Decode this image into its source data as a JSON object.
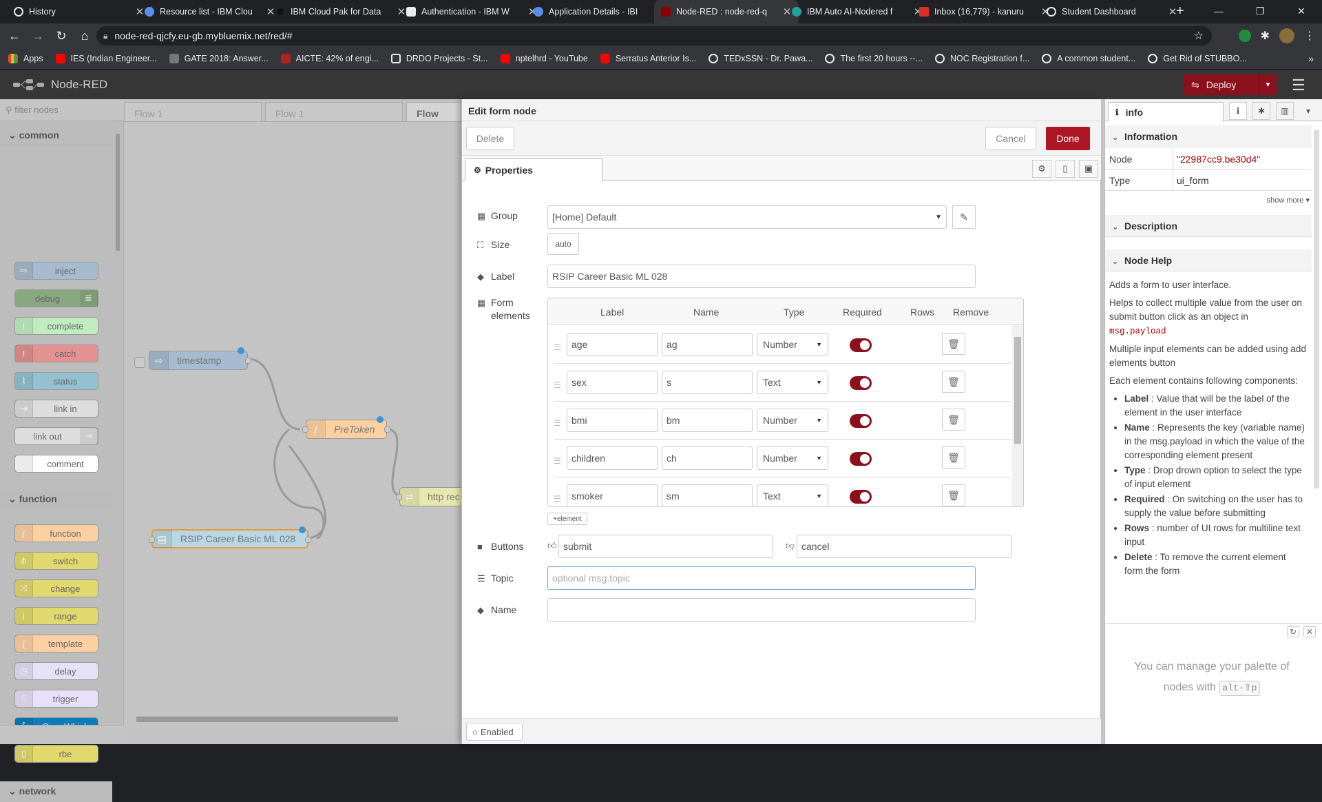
{
  "browser": {
    "tabs": [
      {
        "title": "History",
        "active": false
      },
      {
        "title": "Resource list - IBM Clou",
        "active": false
      },
      {
        "title": "IBM Cloud Pak for Data",
        "active": false
      },
      {
        "title": "Authentication - IBM W",
        "active": false
      },
      {
        "title": "Application Details - IBI",
        "active": false
      },
      {
        "title": "Node-RED : node-red-q",
        "active": true
      },
      {
        "title": "IBM Auto AI-Nodered f",
        "active": false
      },
      {
        "title": "Inbox (16,779) - kanuru",
        "active": false
      },
      {
        "title": "Student Dashboard",
        "active": false
      }
    ],
    "url": "node-red-qjcfy.eu-gb.mybluemix.net/red/#",
    "bookmarks": [
      "Apps",
      "IES (Indian Engineer...",
      "GATE 2018: Answer...",
      "AICTE: 42% of engi...",
      "DRDO Projects - St...",
      "nptelhrd - YouTube",
      "Serratus Anterior Is...",
      "TEDxSSN - Dr. Pawa...",
      "The first 20 hours --...",
      "NOC Registration f...",
      "A common student...",
      "Get Rid of STUBBO..."
    ]
  },
  "header": {
    "title": "Node-RED",
    "deploy_label": "Deploy"
  },
  "palette": {
    "filter_placeholder": "filter nodes",
    "categories": [
      {
        "name": "common",
        "nodes": [
          "inject",
          "debug",
          "complete",
          "catch",
          "status",
          "link in",
          "link out",
          "comment"
        ]
      },
      {
        "name": "function",
        "nodes": [
          "function",
          "switch",
          "change",
          "range",
          "template",
          "delay",
          "trigger",
          "OpenWhisk",
          "rbe"
        ]
      },
      {
        "name": "network",
        "nodes": []
      }
    ]
  },
  "workspace": {
    "flow_tabs": [
      "Flow 1",
      "Flow 1",
      "Flow"
    ],
    "nodes": [
      "timestamp",
      "PreToken",
      "RSIP Career Basic ML 028",
      "http rec"
    ]
  },
  "editor": {
    "title": "Edit form node",
    "delete_label": "Delete",
    "cancel_label": "Cancel",
    "done_label": "Done",
    "properties_tab": "Properties",
    "group_label": "Group",
    "group_value": "[Home] Default",
    "size_label": "Size",
    "size_value": "auto",
    "label_label": "Label",
    "label_value": "RSIP Career Basic ML 028",
    "form_elements_label": "Form elements",
    "columns": [
      "Label",
      "Name",
      "Type",
      "Required",
      "Rows",
      "Remove"
    ],
    "elements": [
      {
        "label": "age",
        "name": "ag",
        "type": "Number",
        "required": true
      },
      {
        "label": "sex",
        "name": "s",
        "type": "Text",
        "required": true
      },
      {
        "label": "bmi",
        "name": "bm",
        "type": "Number",
        "required": true
      },
      {
        "label": "children",
        "name": "ch",
        "type": "Number",
        "required": true
      },
      {
        "label": "smoker",
        "name": "sm",
        "type": "Text",
        "required": true
      }
    ],
    "add_element_label": "element",
    "buttons_label": "Buttons",
    "submit_value": "submit",
    "cancel_value": "cancel",
    "topic_label": "Topic",
    "topic_placeholder": "optional msg.topic",
    "name_label": "Name",
    "name_value": "",
    "enabled_label": "Enabled"
  },
  "sidebar": {
    "tab_label": "info",
    "information_title": "Information",
    "node_key": "Node",
    "node_value": "\"22987cc9.be30d4\"",
    "type_key": "Type",
    "type_value": "ui_form",
    "show_more": "show more",
    "description_title": "Description",
    "help_title": "Node Help",
    "help_intro": "Adds a form to user interface.",
    "help_p2a": "Helps to collect multiple value from the user on submit button click as an object in",
    "help_p2code": "msg.payload",
    "help_p3": "Multiple input elements can be added using add elements button",
    "help_p4": "Each element contains following components:",
    "help_items": [
      {
        "term": "Label",
        "text": ": Value that will be the label of the element in the user interface"
      },
      {
        "term": "Name",
        "text": ": Represents the key (variable name) in the msg.payload in which the value of the corresponding element present"
      },
      {
        "term": "Type",
        "text": ": Drop drown option to select the type of input element"
      },
      {
        "term": "Required",
        "text": ": On switching on the user has to supply the value before submitting"
      },
      {
        "term": "Rows",
        "text": ": number of UI rows for multiline text input"
      },
      {
        "term": "Delete",
        "text": ": To remove the current element form the form"
      }
    ],
    "palette_hint_a": "You can manage your palette of nodes with",
    "palette_hint_kbd": "alt-⇧p"
  },
  "colors": {
    "accent": "#8c101c",
    "done": "#ad1625",
    "port_dot": "#3f93cf"
  }
}
